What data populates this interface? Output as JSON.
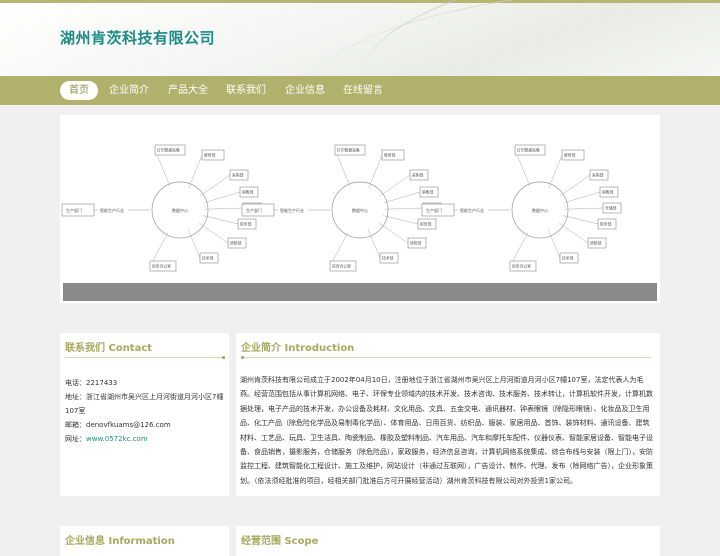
{
  "site": {
    "title": "湖州肯茨科技有限公司"
  },
  "nav": {
    "items": [
      {
        "label": "首页",
        "active": true
      },
      {
        "label": "企业简介",
        "active": false
      },
      {
        "label": "产品大全",
        "active": false
      },
      {
        "label": "联系我们",
        "active": false
      },
      {
        "label": "企业信息",
        "active": false
      },
      {
        "label": "在线留言",
        "active": false
      }
    ]
  },
  "banner": {
    "diagram_labels": {
      "center": "数据中心",
      "top_left": "打印数据采集",
      "top_mid": "维修部",
      "right_1": "采购部",
      "right_2": "销售部",
      "right_3": "仓储部",
      "right_4": "财务部",
      "right_5": "质检部",
      "left_1": "生产部门",
      "left_2": "智能生产行业",
      "bottom_left": "综合办公室",
      "bottom_mid": "技术部"
    }
  },
  "contact": {
    "title": "联系我们 Contact",
    "phone": "电话：2217433",
    "address": "地址：浙江省湖州市吴兴区上月河街道月河小区7幢107室",
    "email": "邮箱：denovfkuams@126.com",
    "website_label": "网址：",
    "website": "www.0572kc.com"
  },
  "intro": {
    "title": "企业简介 Introduction",
    "text": "湖州肯茨科技有限公司成立于2002年04月10日，注册地位于浙江省湖州市吴兴区上月河街道月河小区7幢107室，法定代表人为毛燕。经营范围包括从事计算机网络、电子、环保专业领域内的技术开发、技术咨询、技术服务、技术转让，计算机软件开发，计算机数据处理，电子产品的技术开发，办公设备及耗材、文化用品、文具、五金交电、通讯器材、钟表眼镜（除隐形眼镜）、化妆品及卫生用品、化工产品（除危险化学品及易制毒化学品）、体育用品、日用百货、纺织品、服装、家居用品、首饰、装饰材料、通讯设备、建筑材料、工艺品、玩具、卫生洁具、陶瓷制品、橡胶及塑料制品、汽车用品、汽车和摩托车配件、仪器仪表、智能家居设备、智能电子设备、食品销售，摄影服务，仓储服务（除危险品），家政服务，经济信息咨询，计算机网络系统集成、综合布线与安装（限上门），安防监控工程、建筑智能化工程设计、施工及维护，网站设计（非通过互联网），广告设计、制作、代理、发布（除网络广告），企业形象策划。（依法须经批准的项目，经相关部门批准后方可开展经营活动）湖州肯茨科技有限公司对外投资1家公司。"
  },
  "bottom": {
    "info_title": "企业信息 Information",
    "scope_title": "经营范围 Scope"
  }
}
